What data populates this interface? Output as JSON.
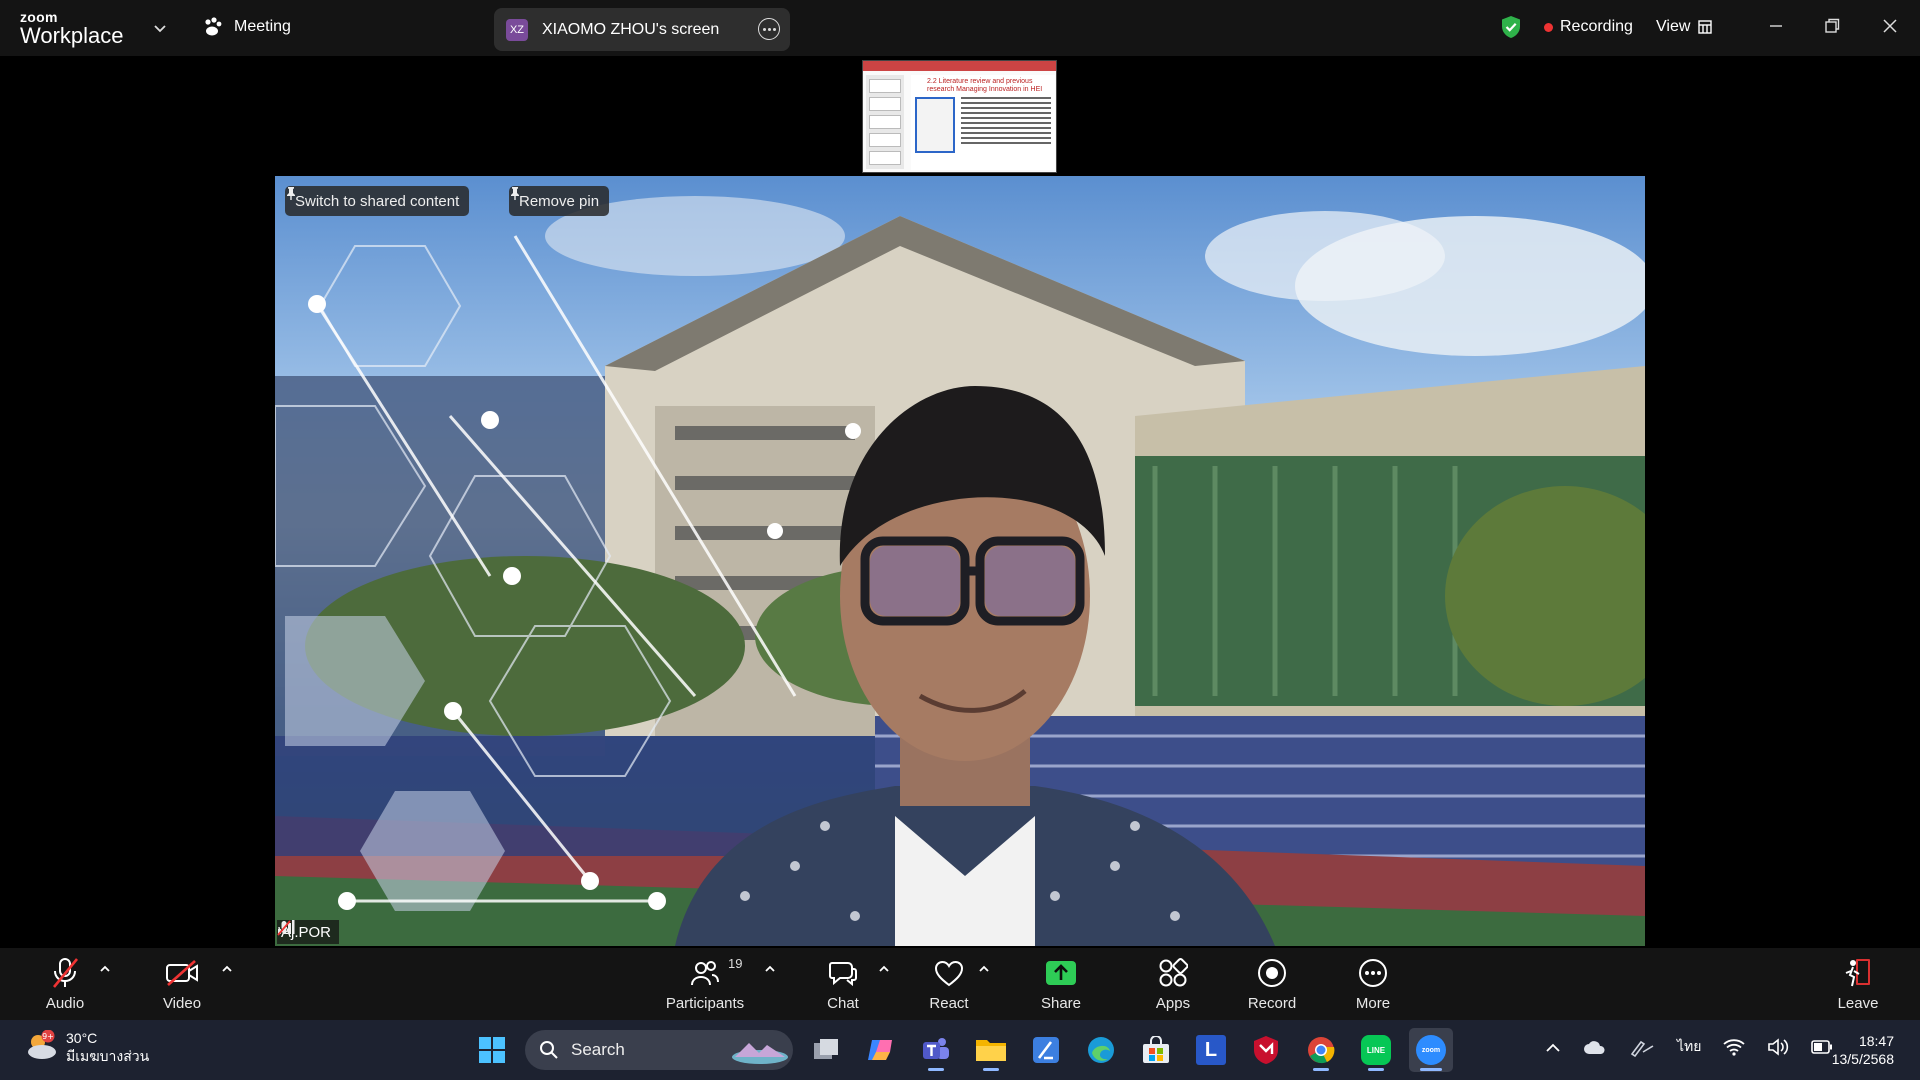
{
  "topbar": {
    "logo_small": "zoom",
    "logo_big": "Workplace",
    "meeting_label": "Meeting",
    "screen_badge": "XZ",
    "screen_title": "XIAOMO ZHOU's screen",
    "recording_label": "Recording",
    "view_label": "View"
  },
  "thumbnail": {
    "slide_title": "2.2 Literature review and previous research Managing Innovation in HEI"
  },
  "video": {
    "switch_label": "Switch to shared content",
    "remove_pin_label": "Remove pin",
    "participant_name": "Aj.POR"
  },
  "toolbar": {
    "audio": "Audio",
    "video": "Video",
    "participants": "Participants",
    "participants_count": "19",
    "chat": "Chat",
    "react": "React",
    "share": "Share",
    "apps": "Apps",
    "record": "Record",
    "more": "More",
    "leave": "Leave"
  },
  "taskbar": {
    "weather_badge": "9+",
    "temperature": "30°C",
    "location": "มีเมฆบางส่วน",
    "search_label": "Search",
    "language": "ไทย",
    "time": "18:47",
    "date": "13/5/2568",
    "line_label": "LINE",
    "zoom_label": "zoom",
    "l_label": "L"
  },
  "colors": {
    "share_green": "#2ecc56",
    "recording_red": "#e33333",
    "shield_green": "#2fb24a"
  }
}
